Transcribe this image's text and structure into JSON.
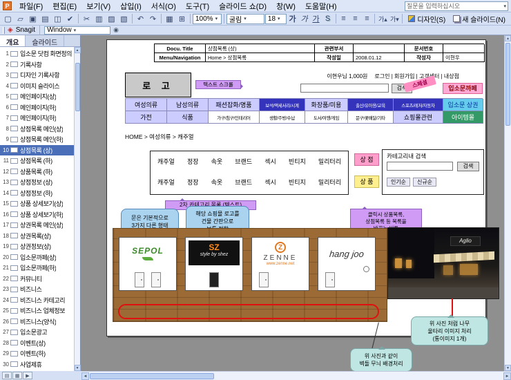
{
  "app": {
    "menu": [
      "파일(F)",
      "편집(E)",
      "보기(V)",
      "삽입(I)",
      "서식(O)",
      "도구(T)",
      "슬라이드 쇼(D)",
      "창(W)",
      "도움말(H)"
    ],
    "question_box": "질문을 입력하십시오",
    "toolbar_icons": [
      {
        "name": "new-file-icon",
        "glyph": "▢"
      },
      {
        "name": "open-file-icon",
        "glyph": "▱"
      },
      {
        "name": "save-icon",
        "glyph": "▣"
      },
      {
        "name": "print-icon",
        "glyph": "▤"
      },
      {
        "name": "print-preview-icon",
        "glyph": "◫"
      },
      {
        "name": "spelling-icon",
        "glyph": "✔"
      },
      {
        "name": "separator",
        "glyph": ""
      },
      {
        "name": "cut-icon",
        "glyph": "✂"
      },
      {
        "name": "copy-icon",
        "glyph": "▥"
      },
      {
        "name": "paste-icon",
        "glyph": "▨"
      },
      {
        "name": "format-painter-icon",
        "glyph": "▧"
      },
      {
        "name": "separator",
        "glyph": ""
      },
      {
        "name": "undo-icon",
        "glyph": "↶"
      },
      {
        "name": "redo-icon",
        "glyph": "↷"
      },
      {
        "name": "separator",
        "glyph": ""
      },
      {
        "name": "insert-chart-icon",
        "glyph": "▦"
      },
      {
        "name": "insert-table-icon",
        "glyph": "⊞"
      },
      {
        "name": "separator",
        "glyph": ""
      }
    ],
    "zoom": "100%",
    "font_name": "굴림",
    "font_size": "18",
    "fmt_char": "가",
    "shadow_char": "S",
    "align_glyph": "≡",
    "grow_glyph": "가▴",
    "shrink_glyph": "가▾",
    "design_label": "디자인(S)",
    "new_slide_label": "새 슬라이드(N)",
    "snagit": {
      "icon_glyph": "◈",
      "label": "Snagit",
      "window": "Window",
      "camera_glyph": "◉"
    },
    "scroll_up_glyph": "▲",
    "scroll_down_glyph": "▼",
    "scroll_left_glyph": "◄",
    "scroll_right_glyph": "►",
    "view_normal_glyph": "▤",
    "view_sorter_glyph": "▦",
    "view_show_glyph": "▶",
    "app_icon_letter": "P"
  },
  "sidebar": {
    "tabs": [
      "개요",
      "슬라이드"
    ],
    "selected": 10,
    "items": [
      "입소문 닷컴 화면정의",
      "기록사항",
      "디자인 기록사항",
      "이미지 슬라이스",
      "메인페이지(상)",
      "메인페이지(하)",
      "메인페이지(하)",
      "상점목록 메인(상)",
      "상점목록 메인(하)",
      "상점목록 (상)",
      "상점목록 (하)",
      "상품목록 (하)",
      "상점정보 (상)",
      "상점정보 (하)",
      "상품 상세보기(상)",
      "상품 상세보기(하)",
      "상권목록 메인(상)",
      "상권목록(상)",
      "상권정보(상)",
      "입소문까페(상)",
      "입소문까페(하)",
      "커뮤니티",
      "비즈니스",
      "비즈니스 카테고리",
      "비즈니스 업체정보",
      "비즈니스(양식)",
      "입소문광고",
      "이벤트(상)",
      "이벤트(하)",
      "사업제휴"
    ]
  },
  "slide": {
    "doc": {
      "title_label": "Docu. Title",
      "title_value": "상점목록 (상)",
      "dept_label": "관련부서",
      "dept_value": "",
      "docno_label": "문서번호",
      "docno_value": "",
      "nav_label": "Menu/Navigation",
      "nav_value": "Home > 상점목록",
      "date_label": "작성일",
      "date_value": "2008.01.12",
      "author_label": "작성자",
      "author_value": "이현우"
    },
    "header": {
      "logo": "로 고",
      "text_scroll_note": "텍스트 스크롤",
      "user_info": "이현우님 1,000원",
      "links": "로그인 | 회원가입 | 고객센터 | 내상점",
      "search_button": "검색",
      "special_ribbon": "스페셜",
      "cafe_button": "입소문까페"
    },
    "nav_rows": [
      [
        {
          "label": "여성의류",
          "bg": "#ccccff",
          "fg": "#000000",
          "sm": 0
        },
        {
          "label": "남성의류",
          "bg": "#ccccff",
          "fg": "#000000",
          "sm": 0
        },
        {
          "label": "패션잡화/명품",
          "bg": "#ccccff",
          "fg": "#000000",
          "sm": 0
        },
        {
          "label": "보석/액세서리/시계",
          "bg": "#3333bb",
          "fg": "#ffffff",
          "sm": 1
        },
        {
          "label": "화장품/미용",
          "bg": "#ccccff",
          "fg": "#000000",
          "sm": 0
        },
        {
          "label": "출산/유아용/교육",
          "bg": "#3333bb",
          "fg": "#ffffff",
          "sm": 1
        },
        {
          "label": "스포츠/레저/자동차",
          "bg": "#3333bb",
          "fg": "#ffffff",
          "sm": 1
        },
        {
          "label": "입소문 상권",
          "bg": "#66ccee",
          "fg": "#003399",
          "sm": 0
        }
      ],
      [
        {
          "label": "가전",
          "bg": "#ccccff",
          "fg": "#000000",
          "sm": 0
        },
        {
          "label": "식품",
          "bg": "#ccccff",
          "fg": "#000000",
          "sm": 0
        },
        {
          "label": "가구/침구/인테리어",
          "bg": "#ffffff",
          "fg": "#000000",
          "sm": 1
        },
        {
          "label": "생활/주방/수납",
          "bg": "#ffffff",
          "fg": "#000000",
          "sm": 1
        },
        {
          "label": "도서/여행/게임",
          "bg": "#ffffff",
          "fg": "#000000",
          "sm": 1
        },
        {
          "label": "문구/꽃배달/기타",
          "bg": "#ffffff",
          "fg": "#000000",
          "sm": 1
        },
        {
          "label": "쇼핑몰관련",
          "bg": "#ccccff",
          "fg": "#000000",
          "sm": 0
        },
        {
          "label": "아이템몰",
          "bg": "#339966",
          "fg": "#ffffff",
          "sm": 0
        }
      ]
    ],
    "breadcrumb": "HOME > 여성의류 > 캐주얼",
    "category": {
      "items": [
        "캐주얼",
        "정장",
        "속옷",
        "브랜드",
        "섹시",
        "빈티지",
        "밀리터리"
      ],
      "shop": "상 점",
      "product": "상 품"
    },
    "search_panel": {
      "title": "카테고리내 검색",
      "button": "검색",
      "popular": "인기순",
      "newest": "신규순"
    },
    "notes": {
      "second_category": "2차 카테고리 목록 (텍스트)",
      "toggle": "클릭시 상품목록,\n상점목록 등 목록을\n바꾸는 버튼",
      "door": "문은 기본적으로\n3가지 다른 형태",
      "sign": "해당 쇼핑몰 로고를\n건물 간판으로\n보통 정함",
      "fence": "위 사진 처럼 나무\n울타리 이미지 처리\n(통이미지 1개)",
      "brick": "위 사진과 같이\n벽돌 무늬 배경처리"
    },
    "stores": [
      {
        "name": "SEPOL"
      },
      {
        "name": "SZ",
        "sub": "style by shez"
      },
      {
        "name": "ZENNE",
        "monogram": "Z",
        "url": "www.zenne.net"
      },
      {
        "name": "hang joo"
      }
    ],
    "photo": {
      "sign": "Aglio"
    }
  }
}
